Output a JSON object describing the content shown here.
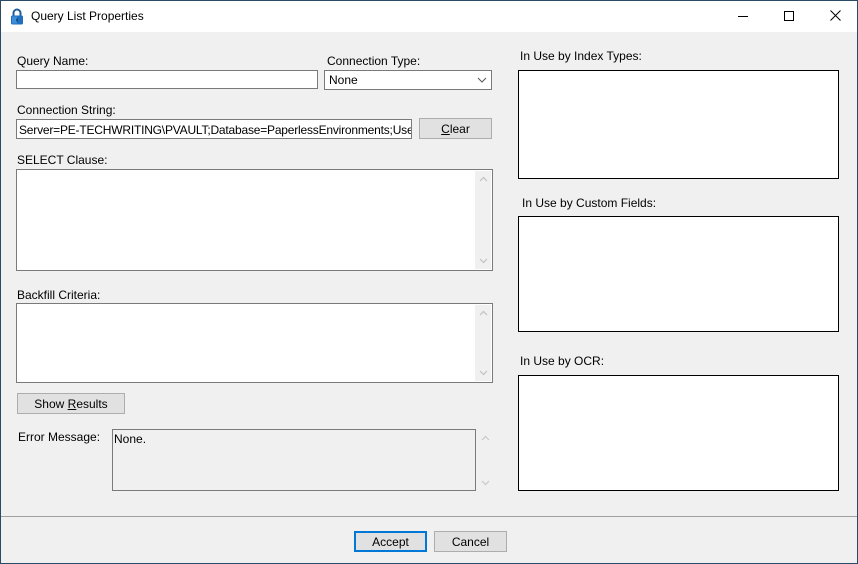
{
  "window": {
    "title": "Query List Properties",
    "icon": "padlock-icon",
    "controls": {
      "minimize": "minimize-icon",
      "maximize": "maximize-icon",
      "close": "close-icon"
    }
  },
  "form": {
    "query_name": {
      "label": "Query Name:",
      "value": ""
    },
    "connection_type": {
      "label": "Connection Type:",
      "selected": "None"
    },
    "connection_string": {
      "label": "Connection String:",
      "value": "Server=PE-TECHWRITING\\PVAULT;Database=PaperlessEnvironments;User ID='",
      "clear_button": {
        "accel": "C",
        "rest": "lear"
      }
    },
    "select_clause": {
      "label": "SELECT Clause:",
      "value": ""
    },
    "backfill_criteria": {
      "label": "Backfill Criteria:",
      "value": ""
    },
    "show_results_button": {
      "before": "Show ",
      "accel": "R",
      "after": "esults"
    },
    "error_message": {
      "label": "Error Message:",
      "value": "None."
    }
  },
  "usage": {
    "index_types": {
      "label": "In Use by Index Types:",
      "items": []
    },
    "custom_fields": {
      "label": "In Use by Custom Fields:",
      "items": []
    },
    "ocr": {
      "label": "In Use by OCR:",
      "items": []
    }
  },
  "footer": {
    "accept": "Accept",
    "cancel": "Cancel"
  }
}
